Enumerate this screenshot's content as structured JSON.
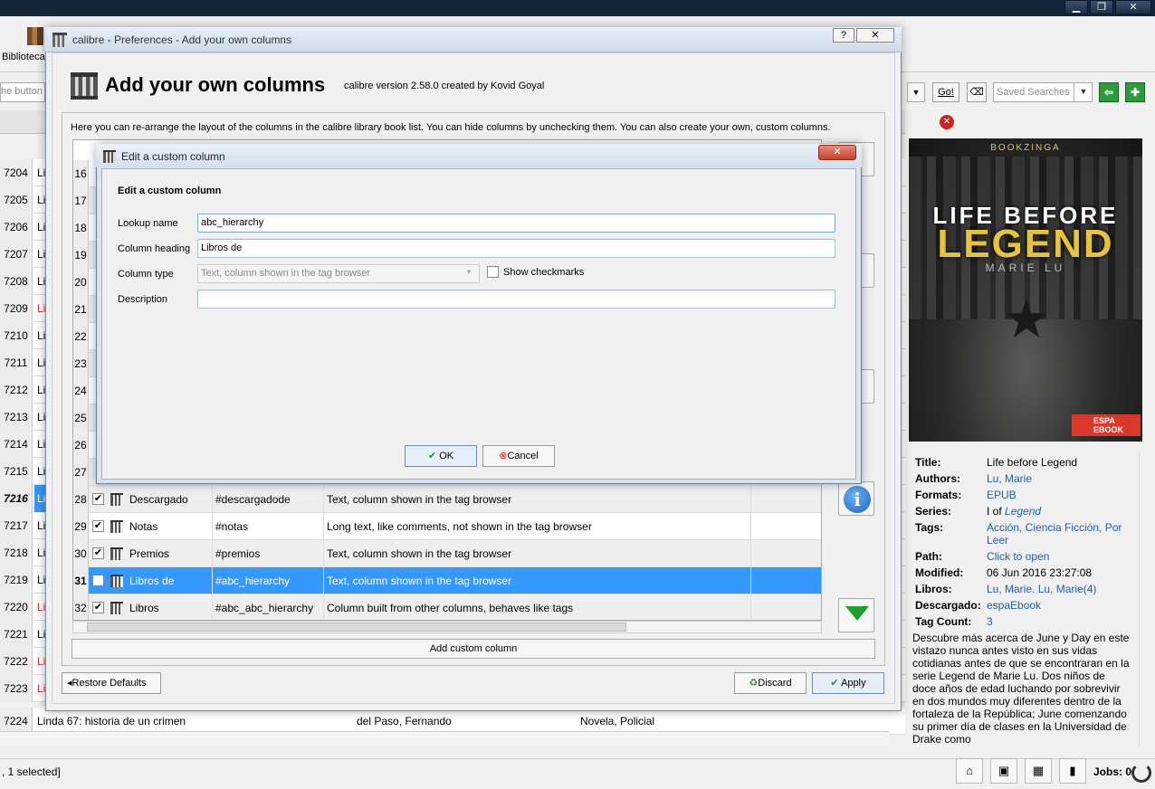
{
  "main": {
    "toolbar": {
      "library_label": "Biblioteca"
    },
    "search": {
      "left_placeholder": "he button t",
      "go_label": "Go!",
      "saved_searches_placeholder": "Saved Searches"
    },
    "library_rows": [
      {
        "num": "7204",
        "c1": "Li",
        "red": false
      },
      {
        "num": "7205",
        "c1": "Li",
        "red": false
      },
      {
        "num": "7206",
        "c1": "Li",
        "red": false
      },
      {
        "num": "7207",
        "c1": "Li",
        "red": false
      },
      {
        "num": "7208",
        "c1": "Li",
        "red": false
      },
      {
        "num": "7209",
        "c1": "Li",
        "red": true
      },
      {
        "num": "7210",
        "c1": "Li",
        "red": false
      },
      {
        "num": "7211",
        "c1": "Li",
        "red": false
      },
      {
        "num": "7212",
        "c1": "Li",
        "red": false
      },
      {
        "num": "7213",
        "c1": "Li",
        "red": false
      },
      {
        "num": "7214",
        "c1": "Li",
        "red": false
      },
      {
        "num": "7215",
        "c1": "Li",
        "red": false
      },
      {
        "num": "7216",
        "c1": "Li",
        "red": false
      },
      {
        "num": "7217",
        "c1": "Li",
        "red": false
      },
      {
        "num": "7218",
        "c1": "Li",
        "red": false
      },
      {
        "num": "7219",
        "c1": "Li",
        "red": false
      },
      {
        "num": "7220",
        "c1": "Li",
        "red": true
      },
      {
        "num": "7221",
        "c1": "Li",
        "red": false
      },
      {
        "num": "7222",
        "c1": "Li",
        "red": true
      },
      {
        "num": "7223",
        "c1": "Li",
        "red": true
      }
    ],
    "last_row": {
      "num": "7224",
      "title": "Linda 67: historia de un crimen",
      "author": "del Paso, Fernando",
      "tags": "Novela, Policial"
    },
    "status_text": ", 1 selected]",
    "jobs_label": "Jobs: 0"
  },
  "book": {
    "cover": {
      "publisher": "BOOKZINGA",
      "title_line1": "LIFE BEFORE",
      "title_line2": "LEGEND",
      "author": "MARIE LU",
      "logo": "ESPA EBOOK"
    },
    "fields": [
      {
        "label": "Title:",
        "value": "Life before Legend",
        "link": false
      },
      {
        "label": "Authors:",
        "value": "Lu, Marie",
        "link": true
      },
      {
        "label": "Formats:",
        "value": "EPUB",
        "link": true
      },
      {
        "label": "Series:",
        "value_prefix": "I of ",
        "value": "Legend",
        "link": true
      },
      {
        "label": "Tags:",
        "value": "Acción, Ciencia Ficción, Por Leer",
        "link": true
      },
      {
        "label": "Path:",
        "value": "Click to open",
        "link": true
      },
      {
        "label": "Modified:",
        "value": "06 Jun 2016 23:27:08",
        "link": false
      },
      {
        "label": "Libros:",
        "value": "Lu, Marie. Lu, Marie(4)",
        "link": true
      },
      {
        "label": "Descargado:",
        "value": "espaEbook",
        "link": true
      },
      {
        "label": "Tag Count:",
        "value": "3",
        "link": true
      }
    ],
    "description": "Descubre más acerca de June y Day en este vistazo nunca antes visto en sus vidas cotidianas antes de que se encontraran en la serie Legend de Marie Lu. Dos niños de doce años de edad luchando por sobrevivir en dos mundos muy diferentes dentro de la fortaleza de la República; June comenzando su primer día de clases en la Universidad de Drake como"
  },
  "prefs": {
    "window_title": "calibre - Preferences - Add your own columns",
    "help_glyph": "?",
    "close_glyph": "✕",
    "heading": "Add your own columns",
    "version": "calibre version 2.58.0 created by Kovid Goyal",
    "help_text": "Here you can re-arrange the layout of the columns in the calibre library book list. You can hide columns by unchecking them. You can also create your own, custom columns.",
    "column_rows": [
      {
        "n": "16"
      },
      {
        "n": "17"
      },
      {
        "n": "18"
      },
      {
        "n": "19"
      },
      {
        "n": "20"
      },
      {
        "n": "21"
      },
      {
        "n": "22"
      },
      {
        "n": "23"
      },
      {
        "n": "24"
      },
      {
        "n": "25"
      },
      {
        "n": "26"
      },
      {
        "n": "27"
      }
    ],
    "columns": [
      {
        "n": "28",
        "checked": true,
        "name": "Descargado",
        "lookup": "#descargadode",
        "type": "Text, column shown in the tag browser"
      },
      {
        "n": "29",
        "checked": true,
        "name": "Notas",
        "lookup": "#notas",
        "type": "Long text, like comments, not shown in the tag browser"
      },
      {
        "n": "30",
        "checked": true,
        "name": "Premios",
        "lookup": "#premios",
        "type": "Text, column shown in the tag browser"
      },
      {
        "n": "31",
        "checked": false,
        "name": "Libros de",
        "lookup": "#abc_hierarchy",
        "type": "Text, column shown in the tag browser"
      },
      {
        "n": "32",
        "checked": true,
        "name": "Libros",
        "lookup": "#abc_abc_hierarchy",
        "type": "Column built from other columns, behaves like tags"
      }
    ],
    "add_custom_column": "Add custom column",
    "restore_defaults": "Restore Defaults",
    "discard": "Discard",
    "apply": "Apply"
  },
  "custom_dialog": {
    "window_title": "Edit a custom column",
    "close_glyph": "✕",
    "heading": "Edit a custom column",
    "lookup_label": "Lookup name",
    "lookup_value": "abc_hierarchy",
    "heading_label": "Column heading",
    "heading_value": "Libros de",
    "type_label": "Column type",
    "type_value": "Text, column shown in the tag browser",
    "show_checkmarks": "Show checkmarks",
    "description_label": "Description",
    "description_value": "",
    "ok": "OK",
    "cancel": "Cancel"
  },
  "colors": {
    "accent": "#3399ff",
    "link": "#1a5fb4",
    "green": "#1e9e2e",
    "red": "#cc2222"
  }
}
